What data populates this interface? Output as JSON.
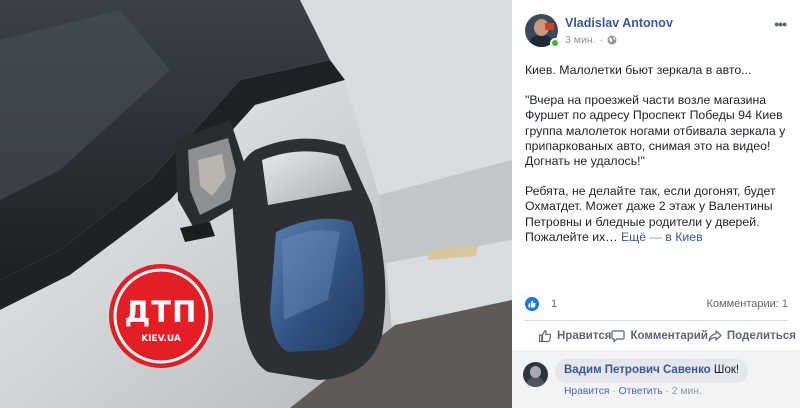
{
  "post": {
    "author": "Vladislav Antonov",
    "time": "3 мин.",
    "paragraphs": [
      "Киев. Малолетки бьют зеркала в авто...",
      "\"Вчера на проезжей части возле магазина Фуршет по адресу Проспект Победы 94 Киев группа малолеток ногами отбивала зеркала у припаркованых авто, снимая это на видео! Догнать не удалось!\"",
      "Ребята, не делайте так, если догонят, будет Охматдет. Может даже 2 этаж у Валентины Петровны и бледные родители у дверей. Пожалейте их…"
    ],
    "more_link": "Ещё",
    "place_sep": "—",
    "place": "в Киев",
    "reactions_count": "1",
    "comments_count": "Комментарии: 1"
  },
  "actions": {
    "like": "Нравится",
    "comment": "Комментарий",
    "share": "Поделиться"
  },
  "comment": {
    "author": "Вадим Петрович Савенко",
    "text": "Шок!",
    "like": "Нравится",
    "reply": "Ответить",
    "time": "2 мин.",
    "sep": "·"
  },
  "watermark": {
    "logo": "ДТП",
    "site": "KIEV.UA"
  },
  "icons": {
    "like": "thumbs-up-icon",
    "comment": "speech-bubble-icon",
    "share": "share-arrow-icon",
    "privacy": "globe-icon",
    "options": "ellipsis-icon"
  },
  "colors": {
    "link": "#385898",
    "like_blue": "#1877f2",
    "muted": "#606770",
    "dtp_red": "#e31e24"
  }
}
